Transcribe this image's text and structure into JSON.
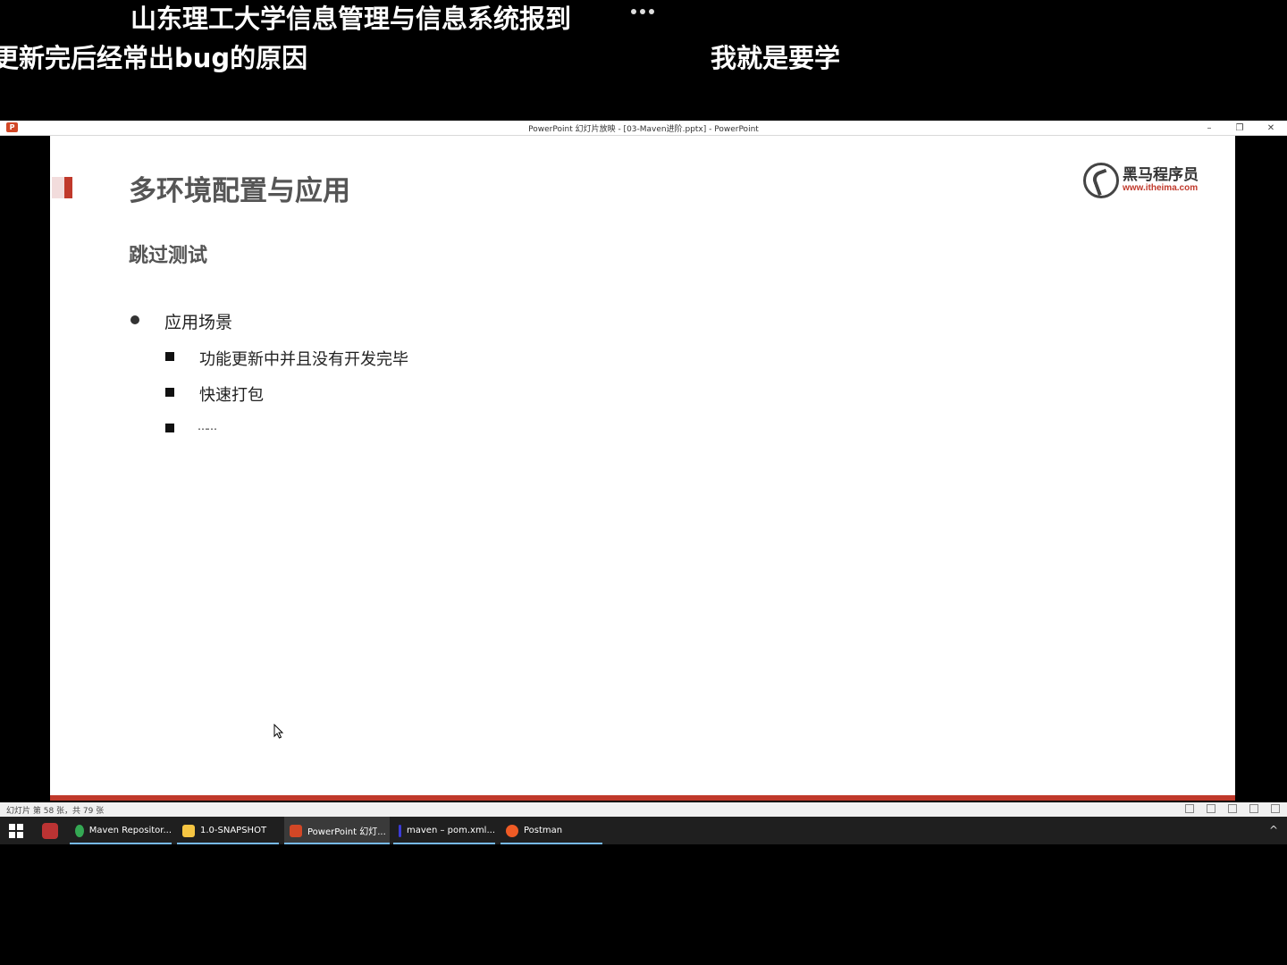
{
  "danmaku": {
    "line1": "山东理工大学信息管理与信息系统报到",
    "line2": "更新完后经常出bug的原因",
    "line3": "我就是要学"
  },
  "window": {
    "title": "PowerPoint 幻灯片放映 - [03-Maven进阶.pptx] - PowerPoint",
    "icon_letter": "P",
    "controls": {
      "minimize": "–",
      "restore": "❐",
      "close": "✕"
    }
  },
  "slide": {
    "title": "多环境配置与应用",
    "subtitle": "跳过测试",
    "bullet": "应用场景",
    "subitems": [
      "功能更新中并且没有开发完毕",
      "快速打包",
      "……"
    ],
    "logo": {
      "name": "黑马程序员",
      "url": "www.itheima.com"
    },
    "accent_color": "#c0392b"
  },
  "status": {
    "slide_counter": "幻灯片 第 58 张，共 79 张"
  },
  "taskbar": {
    "items": [
      {
        "label": "Maven Repositor...",
        "color": "#34a853"
      },
      {
        "label": "1.0-SNAPSHOT",
        "color": "#f5c542"
      },
      {
        "label": "PowerPoint 幻灯...",
        "color": "#d24726"
      },
      {
        "label": "maven – pom.xml...",
        "color": "#3b3bd6"
      },
      {
        "label": "Postman",
        "color": "#ef5b25"
      }
    ],
    "tray_chevron": "^"
  }
}
